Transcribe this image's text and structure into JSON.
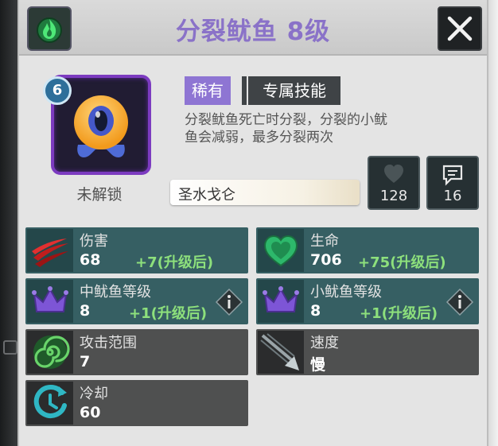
{
  "header": {
    "title": "分裂鱿鱼 8级"
  },
  "unit": {
    "level_badge": "6",
    "status": "未解锁",
    "rarity": "稀有",
    "skill_tab": "专属技能",
    "description_lines": [
      "分裂鱿鱼死亡时分裂，分裂的小鱿",
      "鱼会减弱，最多分裂两次"
    ]
  },
  "search": {
    "value": "圣水戈仑"
  },
  "social": {
    "likes": "128",
    "comments": "16"
  },
  "stats": {
    "damage": {
      "label": "伤害",
      "value": "68",
      "bonus": "+7(升级后)"
    },
    "health": {
      "label": "生命",
      "value": "706",
      "bonus": "+75(升级后)"
    },
    "mid_squid_level": {
      "label": "中鱿鱼等级",
      "value": "8",
      "bonus": "+1(升级后)"
    },
    "small_squid_level": {
      "label": "小鱿鱼等级",
      "value": "8",
      "bonus": "+1(升级后)"
    },
    "attack_range": {
      "label": "攻击范围",
      "value": "7"
    },
    "speed": {
      "label": "速度",
      "value": "慢"
    },
    "cooldown": {
      "label": "冷却",
      "value": "60"
    }
  },
  "colors": {
    "title": "#8a72c8",
    "rarity_tag": "#8e75d3",
    "avatar_border": "#7c3bc0",
    "bonus_text": "#8de07c",
    "teal_card": "#365f63",
    "gray_card": "#4f5050"
  },
  "icons": {
    "header_left": "flame-icon",
    "close": "close-icon",
    "likes": "heart-icon",
    "comments": "message-icon",
    "damage": "claw-slash-icon",
    "health": "heart-icon",
    "level": "crown-icon",
    "info": "info-icon",
    "range": "spiral-icon",
    "speed": "arrow-icon",
    "cooldown": "clock-refresh-icon"
  }
}
